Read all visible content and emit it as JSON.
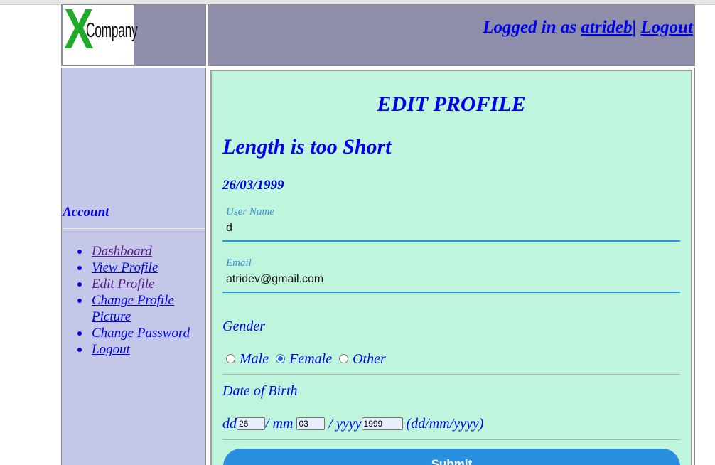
{
  "logo": {
    "letter": "X",
    "text": "Company"
  },
  "header": {
    "logged_in_prefix": "Logged in as ",
    "username": "atrideb",
    "separator": "| ",
    "logout": "Logout"
  },
  "sidebar": {
    "section_title": "Account",
    "items": [
      {
        "label": "Dashboard",
        "visited": true
      },
      {
        "label": "View Profile",
        "visited": false
      },
      {
        "label": "Edit Profile",
        "visited": true
      },
      {
        "label": "Change Profile Picture",
        "visited": false
      },
      {
        "label": "Change Password",
        "visited": false
      },
      {
        "label": "Logout",
        "visited": false
      }
    ]
  },
  "main": {
    "title": "EDIT PROFILE",
    "error_message": "Length is too Short",
    "dob_display": "26/03/1999",
    "username_field": {
      "label": "User Name",
      "value": "d"
    },
    "email_field": {
      "label": "Email",
      "value": "atridev@gmail.com"
    },
    "gender": {
      "label": "Gender",
      "options": [
        "Male",
        "Female",
        "Other"
      ],
      "selected": "Female"
    },
    "dob": {
      "label": "Date of Birth",
      "dd_label": "dd",
      "dd_value": "26",
      "mm_label": "/ mm",
      "mm_value": "03",
      "yyyy_label": " / yyyy",
      "yyyy_value": "1999",
      "format_hint": " (dd/mm/yyyy)"
    },
    "submit_label": "Submit"
  },
  "colors": {
    "header_bg": "#8e8eaa",
    "sidebar_bg": "#c5c7e8",
    "main_bg": "#c0f5dd",
    "link": "#0000ee",
    "visited": "#551a8b",
    "button": "#2a8fde"
  }
}
